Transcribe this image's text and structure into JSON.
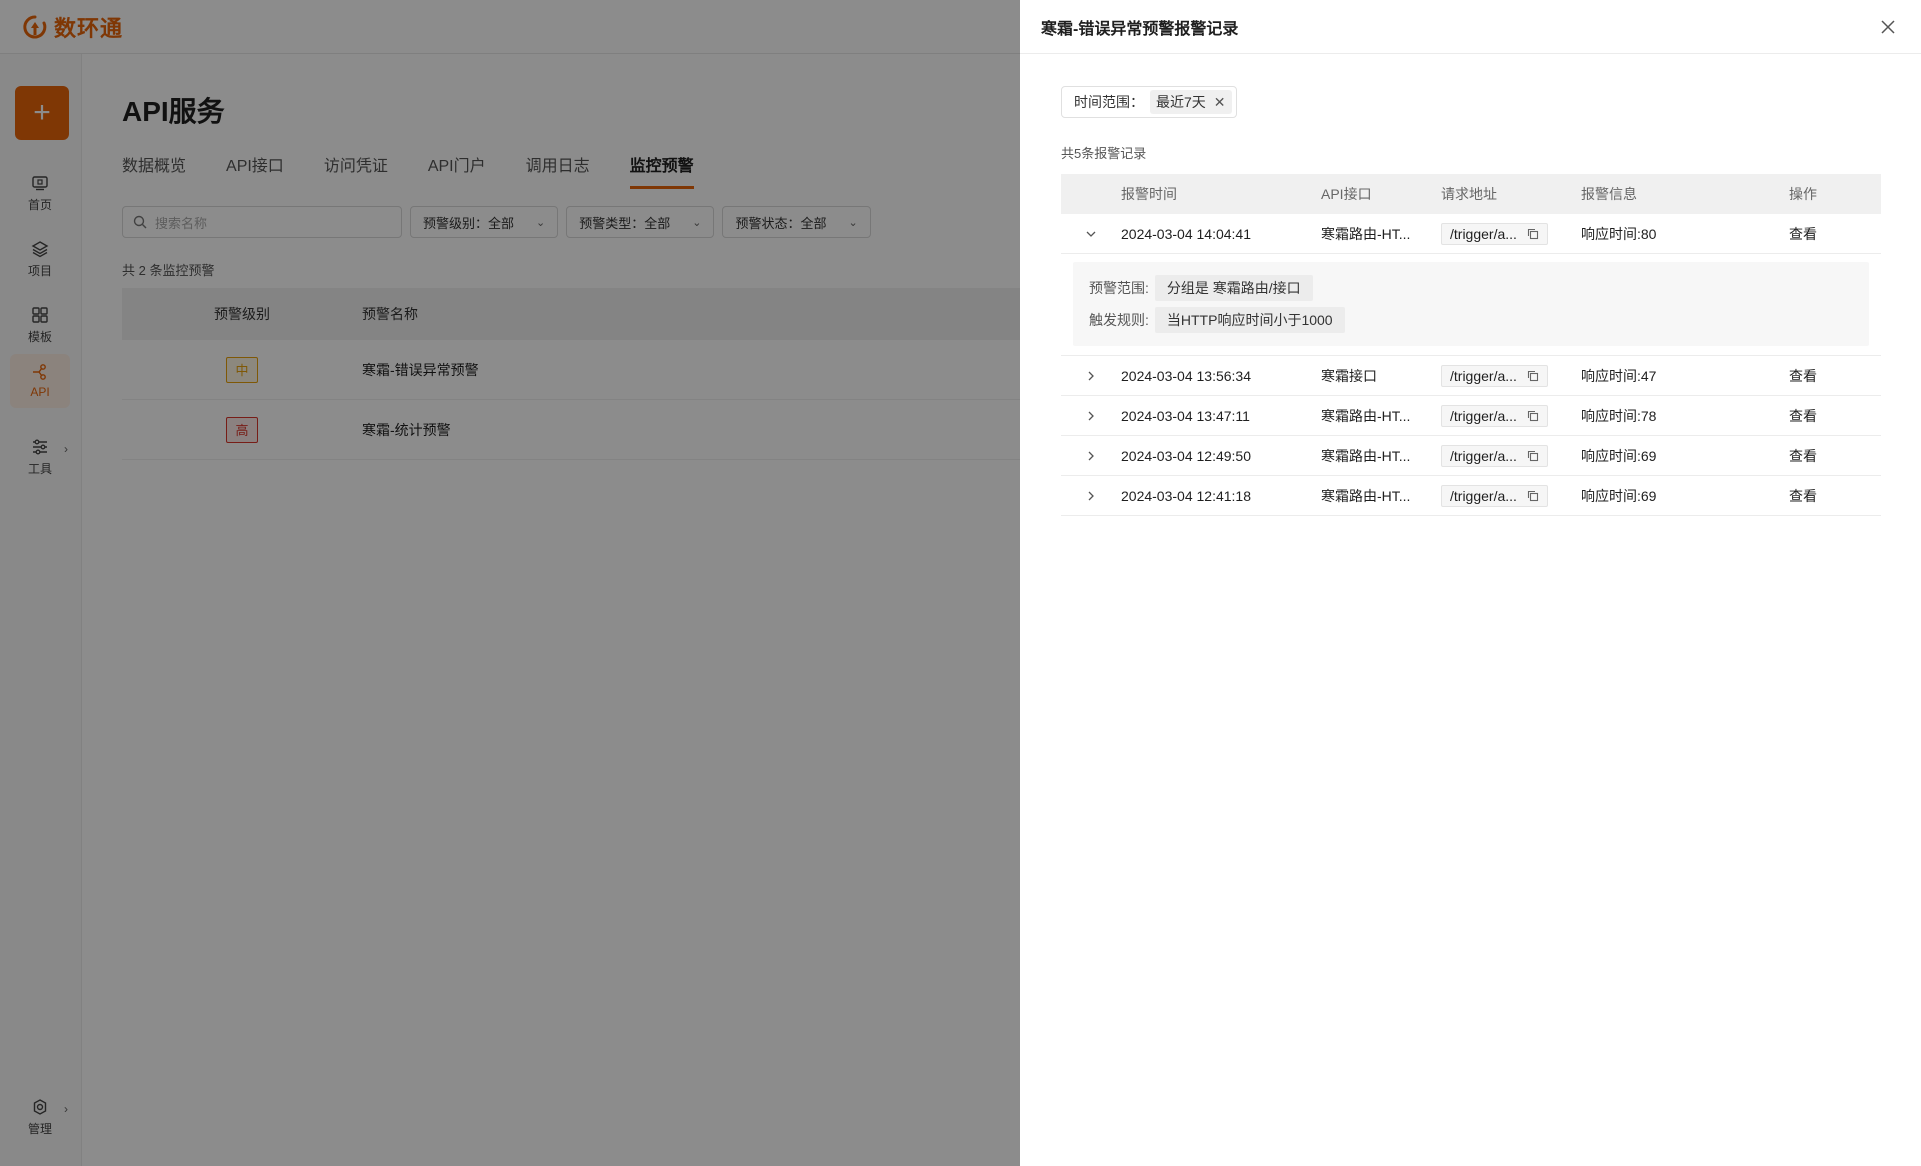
{
  "app": {
    "logo_text": "数环通"
  },
  "sidebar": {
    "add_label": "+",
    "items": [
      {
        "label": "首页",
        "icon": "home-icon"
      },
      {
        "label": "项目",
        "icon": "layers-icon"
      },
      {
        "label": "模板",
        "icon": "grid-icon"
      },
      {
        "label": "API",
        "icon": "api-icon"
      },
      {
        "label": "工具",
        "icon": "sliders-icon"
      },
      {
        "label": "管理",
        "icon": "gear-icon"
      }
    ]
  },
  "page": {
    "title": "API服务",
    "tabs": [
      "数据概览",
      "API接口",
      "访问凭证",
      "API门户",
      "调用日志",
      "监控预警"
    ],
    "search_placeholder": "搜索名称",
    "filters": [
      {
        "label": "预警级别：全部"
      },
      {
        "label": "预警类型：全部"
      },
      {
        "label": "预警状态：全部"
      }
    ],
    "count_text": "共 2 条监控预警",
    "table": {
      "headers": [
        "预警级别",
        "预警名称"
      ],
      "rows": [
        {
          "level": "中",
          "name": "寒霜-错误异常预警"
        },
        {
          "level": "高",
          "name": "寒霜-统计预警"
        }
      ]
    }
  },
  "drawer": {
    "title": "寒霜-错误异常预警报警记录",
    "time_filter_label": "时间范围：",
    "time_filter_value": "最近7天",
    "record_count": "共5条报警记录",
    "headers": [
      "报警时间",
      "API接口",
      "请求地址",
      "报警信息",
      "操作"
    ],
    "rows": [
      {
        "time": "2024-03-04 14:04:41",
        "api": "寒霜路由-HT...",
        "url": "/trigger/a...",
        "info": "响应时间:80",
        "op": "查看",
        "expanded": true
      },
      {
        "time": "2024-03-04 13:56:34",
        "api": "寒霜接口",
        "url": "/trigger/a...",
        "info": "响应时间:47",
        "op": "查看"
      },
      {
        "time": "2024-03-04 13:47:11",
        "api": "寒霜路由-HT...",
        "url": "/trigger/a...",
        "info": "响应时间:78",
        "op": "查看"
      },
      {
        "time": "2024-03-04 12:49:50",
        "api": "寒霜路由-HT...",
        "url": "/trigger/a...",
        "info": "响应时间:69",
        "op": "查看"
      },
      {
        "time": "2024-03-04 12:41:18",
        "api": "寒霜路由-HT...",
        "url": "/trigger/a...",
        "info": "响应时间:69",
        "op": "查看"
      }
    ],
    "detail": {
      "scope_label": "预警范围:",
      "scope_value": "分组是 寒霜路由/接口",
      "rule_label": "触发规则:",
      "rule_value": "当HTTP响应时间小于1000"
    }
  },
  "colors": {
    "accent": "#e8650a",
    "mid_level": "#e7a10b",
    "high_level": "#d9362b"
  }
}
